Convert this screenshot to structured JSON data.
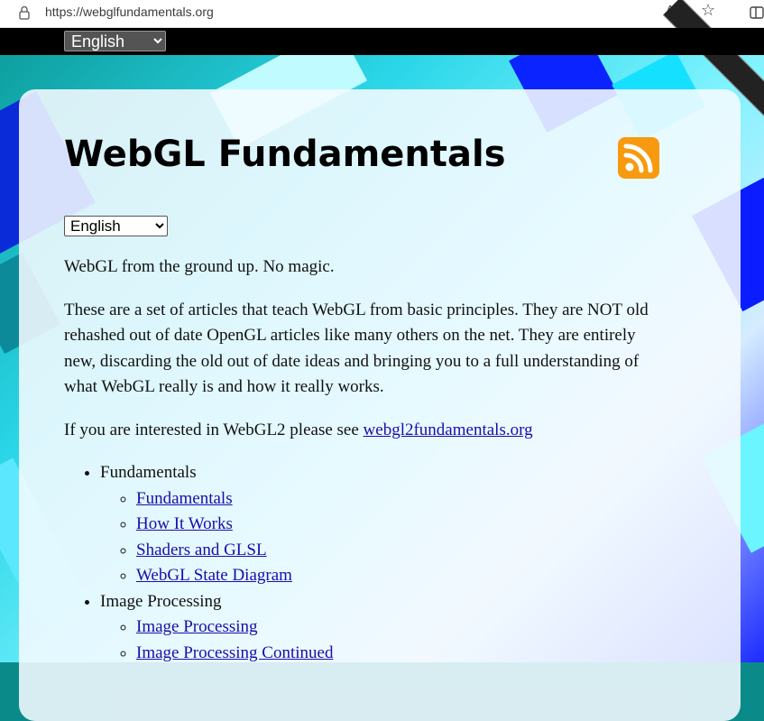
{
  "browser": {
    "url": "https://webglfundamentals.org"
  },
  "top_bar": {
    "language": "English"
  },
  "page": {
    "title": "WebGL Fundamentals",
    "language": "English",
    "intro": "WebGL from the ground up. No magic.",
    "description": "These are a set of articles that teach WebGL from basic principles. They are NOT old rehashed out of date OpenGL articles like many others on the net. They are entirely new, discarding the old out of date ideas and bringing you to a full understanding of what WebGL really is and how it really works.",
    "webgl2_prefix": "If you are interested in WebGL2 please see ",
    "webgl2_link": "webgl2fundamentals.org"
  },
  "sections": [
    {
      "label": "Fundamentals",
      "links": [
        "Fundamentals",
        "How It Works",
        "Shaders and GLSL",
        "WebGL State Diagram"
      ]
    },
    {
      "label": "Image Processing",
      "links": [
        "Image Processing",
        "Image Processing Continued"
      ]
    }
  ],
  "colors": {
    "rss": "#f79a10",
    "link": "#1a0dab"
  },
  "icons": [
    "lock-icon",
    "read-aloud-icon",
    "favorite-star-icon",
    "split-screen-icon",
    "rss-feed-icon"
  ]
}
